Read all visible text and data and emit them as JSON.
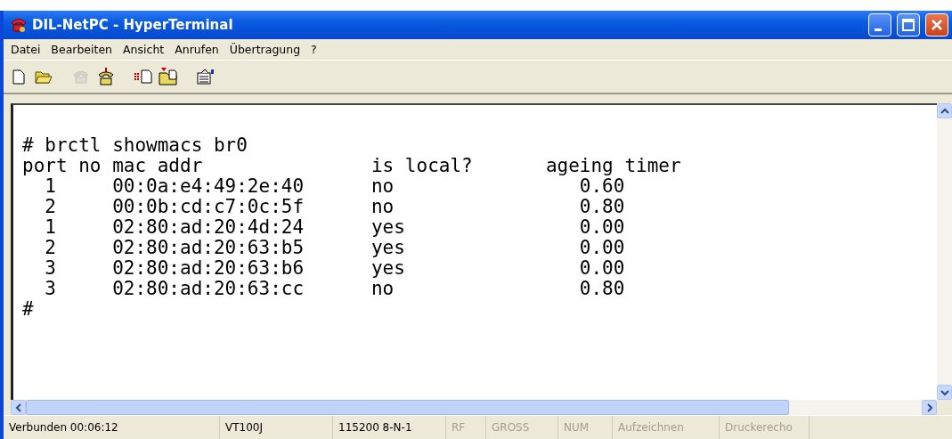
{
  "window": {
    "title": "DIL-NetPC - HyperTerminal"
  },
  "menu": [
    "Datei",
    "Bearbeiten",
    "Ansicht",
    "Anrufen",
    "Übertragung",
    "?"
  ],
  "toolbar": [
    {
      "kind": "new",
      "disabled": false
    },
    {
      "kind": "open",
      "disabled": false
    },
    {
      "kind": "hangup",
      "disabled": true
    },
    {
      "kind": "call",
      "disabled": false
    },
    {
      "kind": "send",
      "disabled": false
    },
    {
      "kind": "receive",
      "disabled": false
    },
    {
      "kind": "properties",
      "disabled": false
    }
  ],
  "terminal": {
    "command": "# brctl showmacs br0",
    "columns": [
      "port no",
      "mac addr",
      "is local?",
      "ageing timer"
    ],
    "rows": [
      [
        "1",
        "00:0a:e4:49:2e:40",
        "no",
        "0.60"
      ],
      [
        "2",
        "00:0b:cd:c7:0c:5f",
        "no",
        "0.80"
      ],
      [
        "1",
        "02:80:ad:20:4d:24",
        "yes",
        "0.00"
      ],
      [
        "2",
        "02:80:ad:20:63:b5",
        "yes",
        "0.00"
      ],
      [
        "3",
        "02:80:ad:20:63:b6",
        "yes",
        "0.00"
      ],
      [
        "3",
        "02:80:ad:20:63:cc",
        "no",
        "0.80"
      ]
    ],
    "prompt": "#"
  },
  "status_bar": [
    {
      "text": "Verbunden 00:06:12",
      "disabled": false
    },
    {
      "text": "VT100J",
      "disabled": false
    },
    {
      "text": "115200 8-N-1",
      "disabled": false
    },
    {
      "text": "RF",
      "disabled": true
    },
    {
      "text": "GROSS",
      "disabled": true
    },
    {
      "text": "NUM",
      "disabled": true
    },
    {
      "text": "Aufzeichnen",
      "disabled": true
    },
    {
      "text": "Druckerecho",
      "disabled": true
    }
  ]
}
